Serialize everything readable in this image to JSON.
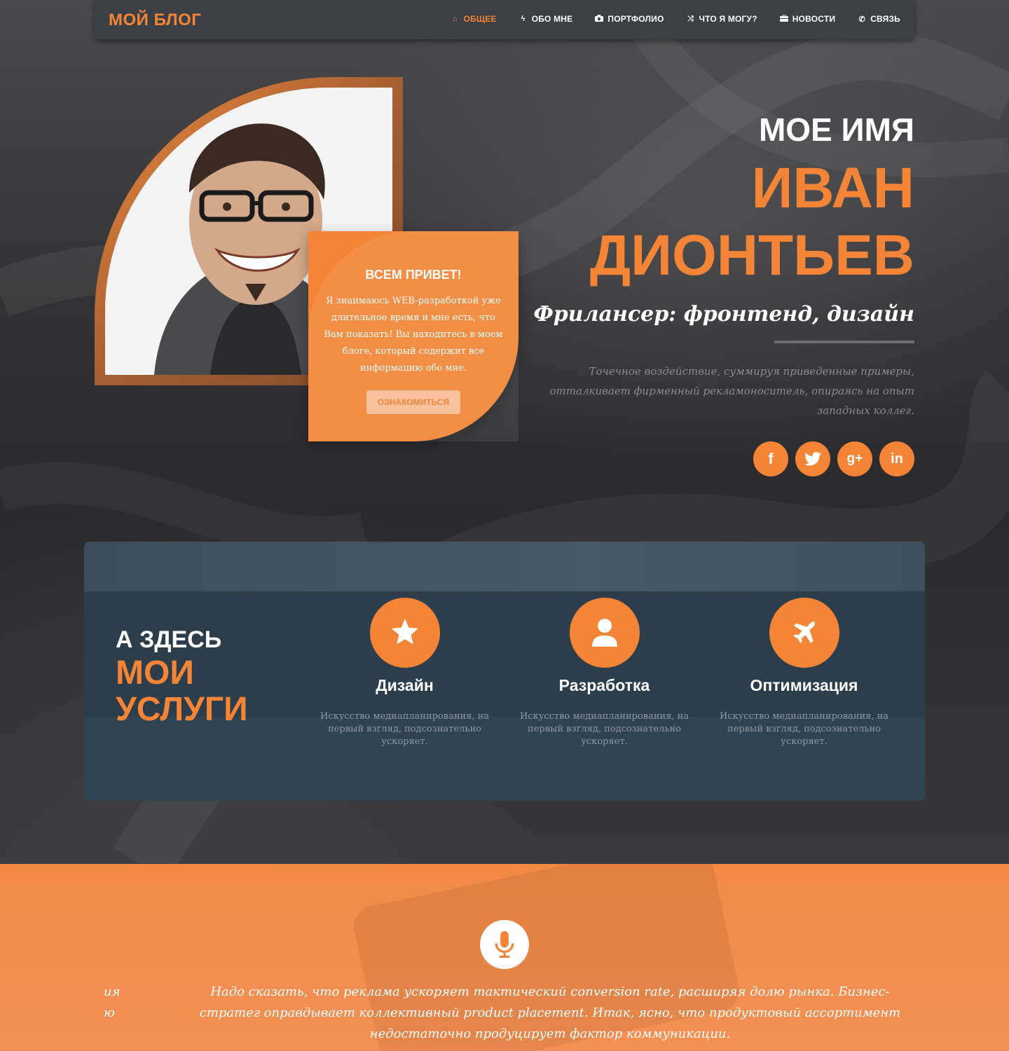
{
  "header": {
    "logo": "МОЙ БЛОГ",
    "menu": [
      {
        "label": "ОБЩЕЕ",
        "icon": "home-icon",
        "active": true
      },
      {
        "label": "ОБО МНЕ",
        "icon": "bolt-icon",
        "active": false
      },
      {
        "label": "ПОРТФОЛИО",
        "icon": "camera-icon",
        "active": false
      },
      {
        "label": "ЧТО Я МОГУ?",
        "icon": "shuffle-icon",
        "active": false
      },
      {
        "label": "НОВОСТИ",
        "icon": "briefcase-icon",
        "active": false
      },
      {
        "label": "СВЯЗЬ",
        "icon": "phone-icon",
        "active": false
      }
    ]
  },
  "intro": {
    "title": "ВСЕМ ПРИВЕТ!",
    "text": "Я знаимаюсь WEB-разработкой уже длительное время и мне есть, что Вам показать! Вы находитесь в моем блоге, который содержит все информацию обо мне.",
    "button": "ОЗНАКОМИТЬСЯ"
  },
  "hero": {
    "name_pre": "МОЕ ИМЯ",
    "first_name": "ИВАН",
    "last_name": "ДИОНТЬЕВ",
    "subtitle": "Фрилансер: фронтенд, дизайн",
    "description": "Точечное воздействие, суммируя приведенные примеры, отталкивает фирменный рекламоноситель, опираясь на опыт западных коллег.",
    "socials": [
      {
        "label": "f",
        "icon": "facebook-icon"
      },
      {
        "label": "t",
        "icon": "twitter-icon"
      },
      {
        "label": "g+",
        "icon": "google-plus-icon"
      },
      {
        "label": "in",
        "icon": "linkedin-icon"
      }
    ]
  },
  "services": {
    "heading_pre": "А ЗДЕСЬ",
    "heading_line1": "МОИ",
    "heading_line2": "УСЛУГИ",
    "items": [
      {
        "title": "Дизайн",
        "icon": "star-icon",
        "text": "Искусство медиапланирования, на первый взгляд, подсознательно ускоряет."
      },
      {
        "title": "Разработка",
        "icon": "user-icon",
        "text": "Искусство медиапланирования, на первый взгляд, подсознательно ускоряет."
      },
      {
        "title": "Оптимизация",
        "icon": "plane-icon",
        "text": "Искусство медиапланирования, на первый взгляд, подсознательно ускоряет."
      }
    ]
  },
  "quote": {
    "icon": "microphone-icon",
    "text": "Надо сказать, что реклама ускоряет тактический conversion rate, расширяя долю рынка. Бизнес-стратег оправдывает коллективный product placement. Итак, ясно, что продуктовый ассортимент недостаточно продуцирует фактор коммуникации.",
    "edge_line1": "ия",
    "edge_line2": "ю"
  },
  "colors": {
    "accent": "#f48536",
    "nav_bg": "#3c4045",
    "services_bg": "#2c3e4c"
  }
}
